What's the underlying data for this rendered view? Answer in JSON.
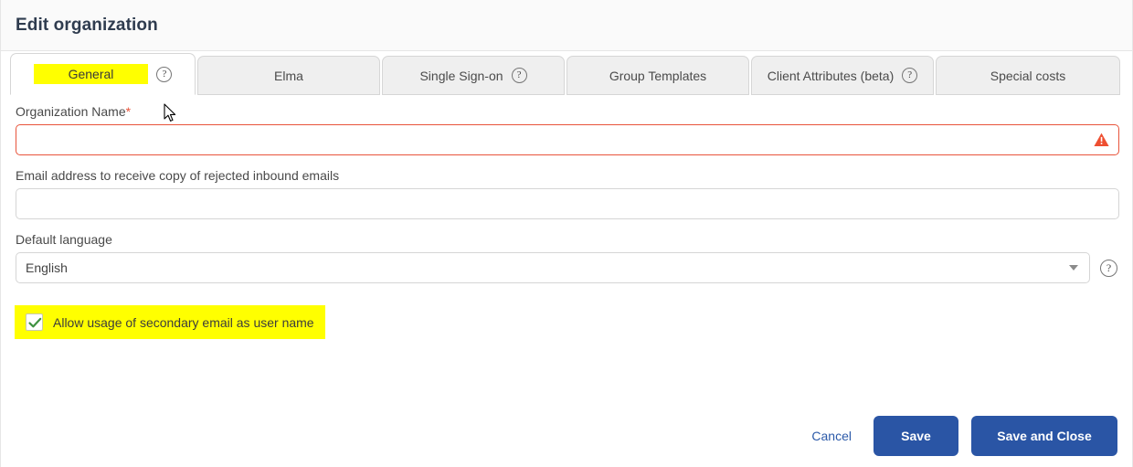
{
  "header": {
    "title": "Edit organization"
  },
  "tabs": [
    {
      "label": "General",
      "help_icon": "question-circle-icon",
      "has_help": true,
      "active": true,
      "highlighted": true
    },
    {
      "label": "Elma",
      "has_help": false,
      "active": false,
      "highlighted": false
    },
    {
      "label": "Single Sign-on",
      "help_icon": "question-circle-icon",
      "has_help": true,
      "active": false,
      "highlighted": false
    },
    {
      "label": "Group Templates",
      "has_help": false,
      "active": false,
      "highlighted": false
    },
    {
      "label": "Client Attributes (beta)",
      "help_icon": "question-circle-icon",
      "has_help": true,
      "active": false,
      "highlighted": false
    },
    {
      "label": "Special costs",
      "has_help": false,
      "active": false,
      "highlighted": false
    }
  ],
  "form": {
    "organization_name": {
      "label": "Organization Name",
      "required_marker": "*",
      "value": "",
      "placeholder": "",
      "has_error": true,
      "error_icon": "warning-triangle-icon"
    },
    "rejected_email": {
      "label": "Email address to receive copy of rejected inbound emails",
      "value": "",
      "placeholder": ""
    },
    "default_language": {
      "label": "Default language",
      "value": "English",
      "caret_icon": "chevron-down-icon",
      "help_icon": "question-circle-icon"
    },
    "secondary_email_checkbox": {
      "label": "Allow usage of secondary email as user name",
      "checked": true,
      "highlighted": true
    }
  },
  "footer": {
    "cancel_label": "Cancel",
    "save_label": "Save",
    "save_and_close_label": "Save and Close"
  },
  "colors": {
    "primary_button": "#2a55a5",
    "link": "#2c5aa9",
    "error": "#e8543b",
    "highlight": "#ffff00",
    "check": "#3f9142",
    "title_text": "#2f3c4f",
    "header_bg": "#fafafa",
    "tab_inactive_bg": "#efefef"
  },
  "cursor": {
    "icon": "arrow-pointer-cursor"
  }
}
